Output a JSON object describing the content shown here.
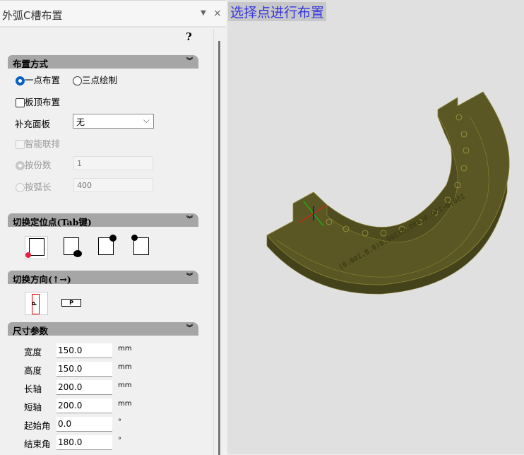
{
  "panel": {
    "title": "外弧C槽布置",
    "pin_icon": "dropdown-triangle",
    "close_icon": "×",
    "help": "?"
  },
  "layout_mode": {
    "header": "布置方式",
    "chevron": "»",
    "one_point": "一点布置",
    "three_point": "三点绘制",
    "selected": "one_point",
    "board_top": "板顶布置",
    "board_top_checked": false,
    "extra_panel_label": "补充面板",
    "extra_panel_value": "无",
    "smart_link": "智能联排",
    "smart_link_checked": false,
    "by_count": "按份数",
    "by_count_value": "1",
    "by_arc": "按弧长",
    "by_arc_value": "400"
  },
  "anchor": {
    "header": "切换定位点(Tab键)",
    "chevron": "»",
    "selected_index": 0
  },
  "direction": {
    "header": "切换方向(↑→)",
    "chevron": "»",
    "glyph": "P",
    "selected_index": 0
  },
  "size": {
    "header": "尺寸参数",
    "chevron": "»",
    "rows": [
      {
        "label": "宽度",
        "value": "150.0",
        "unit": "mm"
      },
      {
        "label": "高度",
        "value": "150.0",
        "unit": "mm"
      },
      {
        "label": "长轴",
        "value": "200.0",
        "unit": "mm"
      },
      {
        "label": "短轴",
        "value": "200.0",
        "unit": "mm"
      },
      {
        "label": "起始角",
        "value": "0.0",
        "unit": "°"
      },
      {
        "label": "结束角",
        "value": "180.0",
        "unit": "°"
      }
    ]
  },
  "viewport": {
    "prompt": "选择点进行布置",
    "model_label": "150.0-150.0C300.0X300.0(0.0,180.0)",
    "model_color": "#5a5724"
  }
}
